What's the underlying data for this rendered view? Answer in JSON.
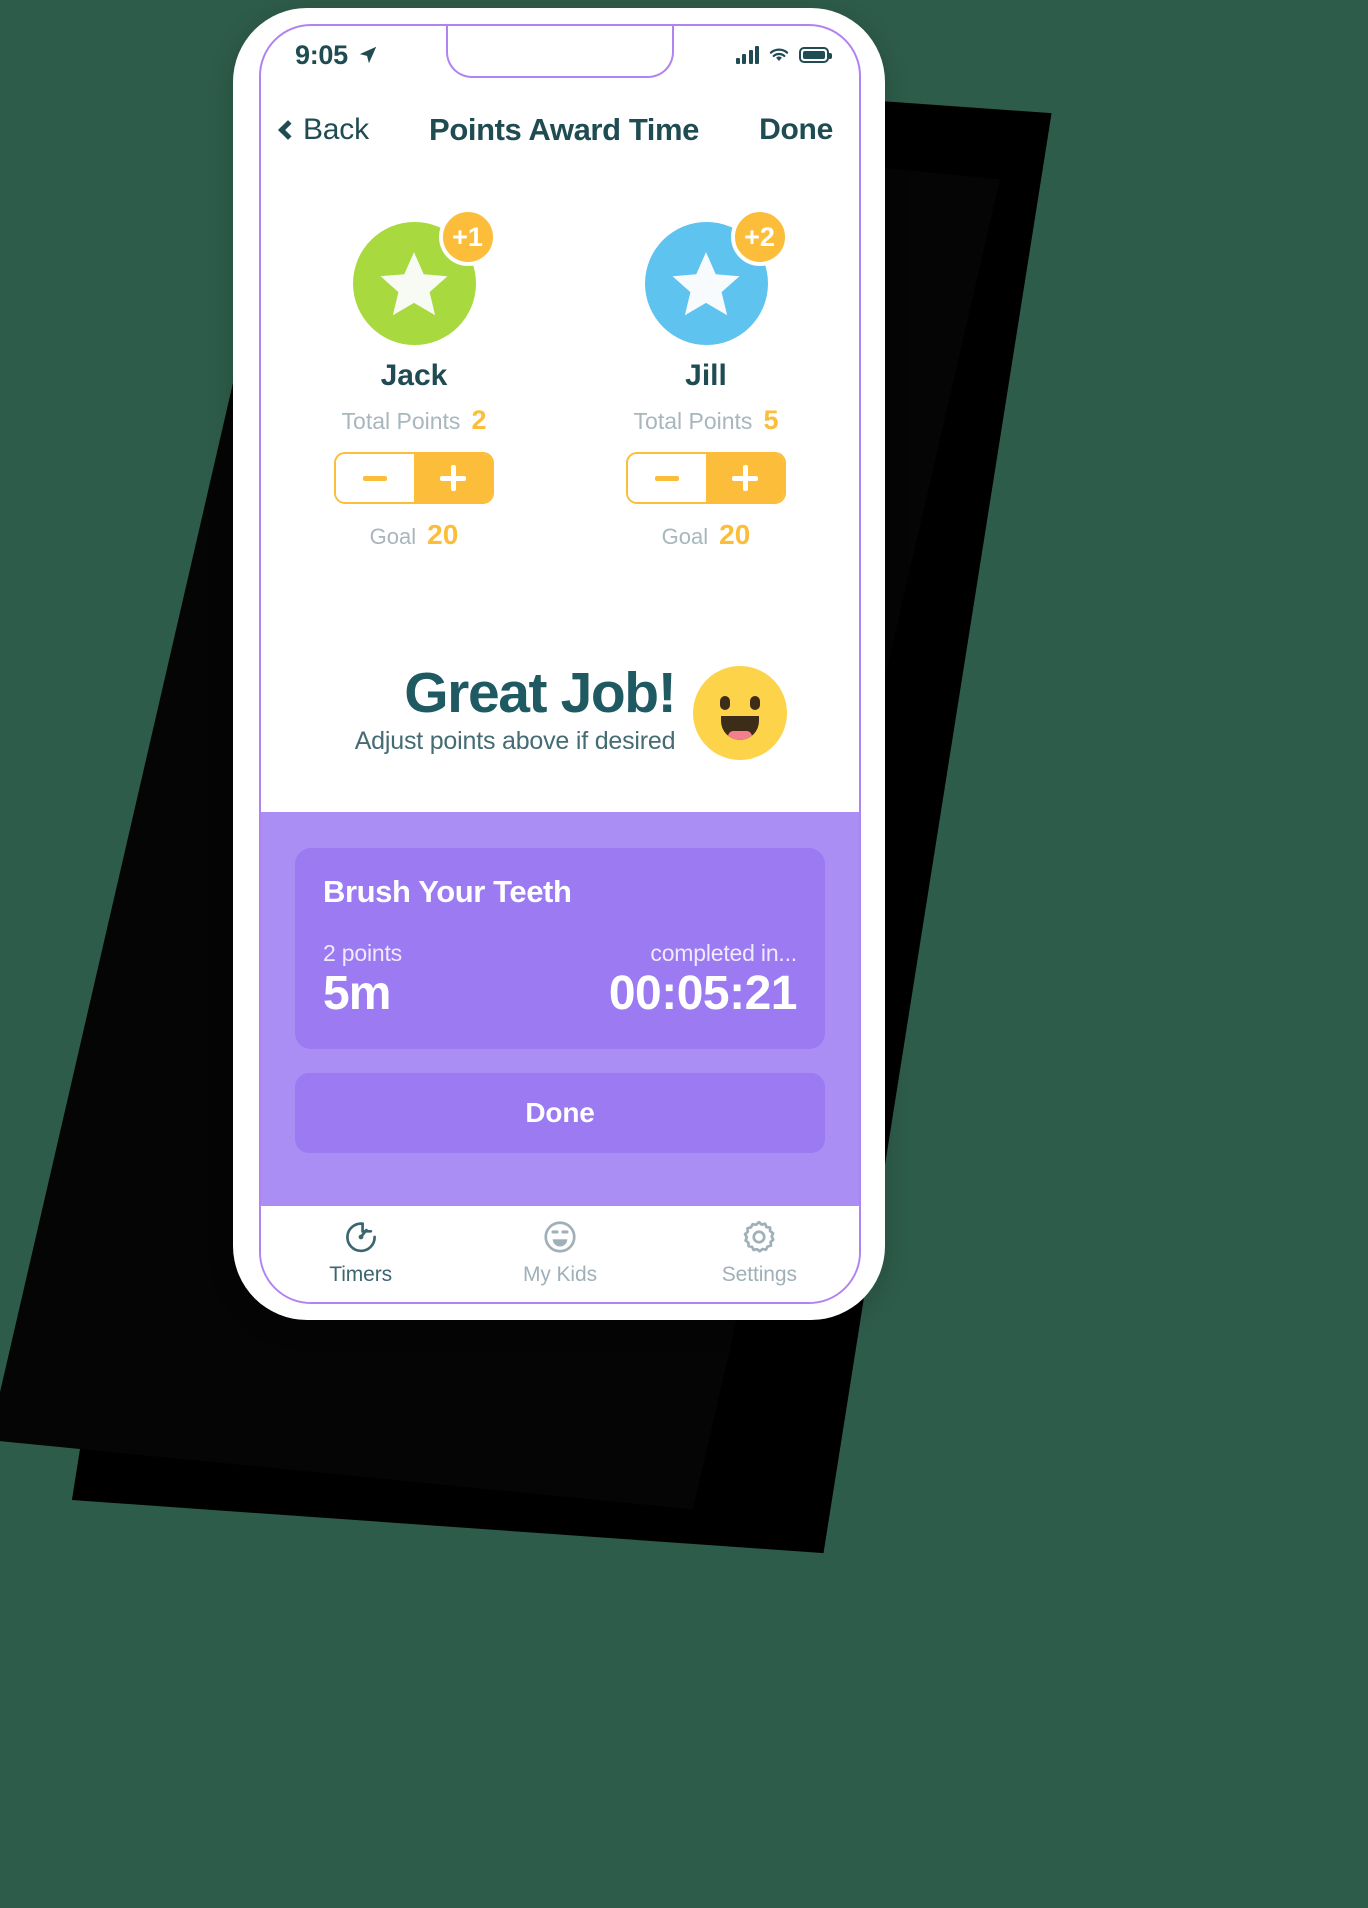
{
  "status_bar": {
    "time": "9:05",
    "location_icon": "location-arrow-icon",
    "cellular_icon": "cellular-bars-icon",
    "wifi_icon": "wifi-icon",
    "battery_icon": "battery-full-icon"
  },
  "nav_bar": {
    "back_label": "Back",
    "title": "Points Award Time",
    "done_label": "Done"
  },
  "kids": [
    {
      "name": "Jack",
      "avatar_color": "#a8d93f",
      "avatar_icon": "star-icon",
      "badge": "+1",
      "points_label": "Total Points",
      "points_value": "2",
      "minus_label": "−",
      "plus_label": "+",
      "goal_label": "Goal",
      "goal_value": "20"
    },
    {
      "name": "Jill",
      "avatar_color": "#5ec3ef",
      "avatar_icon": "star-icon",
      "badge": "+2",
      "points_label": "Total Points",
      "points_value": "5",
      "minus_label": "−",
      "plus_label": "+",
      "goal_label": "Goal",
      "goal_value": "20"
    }
  ],
  "praise": {
    "title": "Great Job!",
    "subtitle": "Adjust points above if desired",
    "emoji_icon": "smiling-face-open-mouth-icon"
  },
  "task": {
    "title": "Brush Your Teeth",
    "points_text": "2 points",
    "duration": "5m",
    "completed_label": "completed in...",
    "elapsed": "00:05:21",
    "done_label": "Done"
  },
  "tabs": [
    {
      "label": "Timers",
      "icon": "timer-icon",
      "active": true
    },
    {
      "label": "My Kids",
      "icon": "smiley-face-icon",
      "active": false
    },
    {
      "label": "Settings",
      "icon": "gear-icon",
      "active": false
    }
  ],
  "colors": {
    "accent_yellow": "#fbbd3a",
    "purple_panel": "#ab8ef4",
    "purple_card": "#9b7af2",
    "teal_text": "#1f4b52",
    "muted_text": "#a8b6bd",
    "background": "#2e5c4a"
  }
}
